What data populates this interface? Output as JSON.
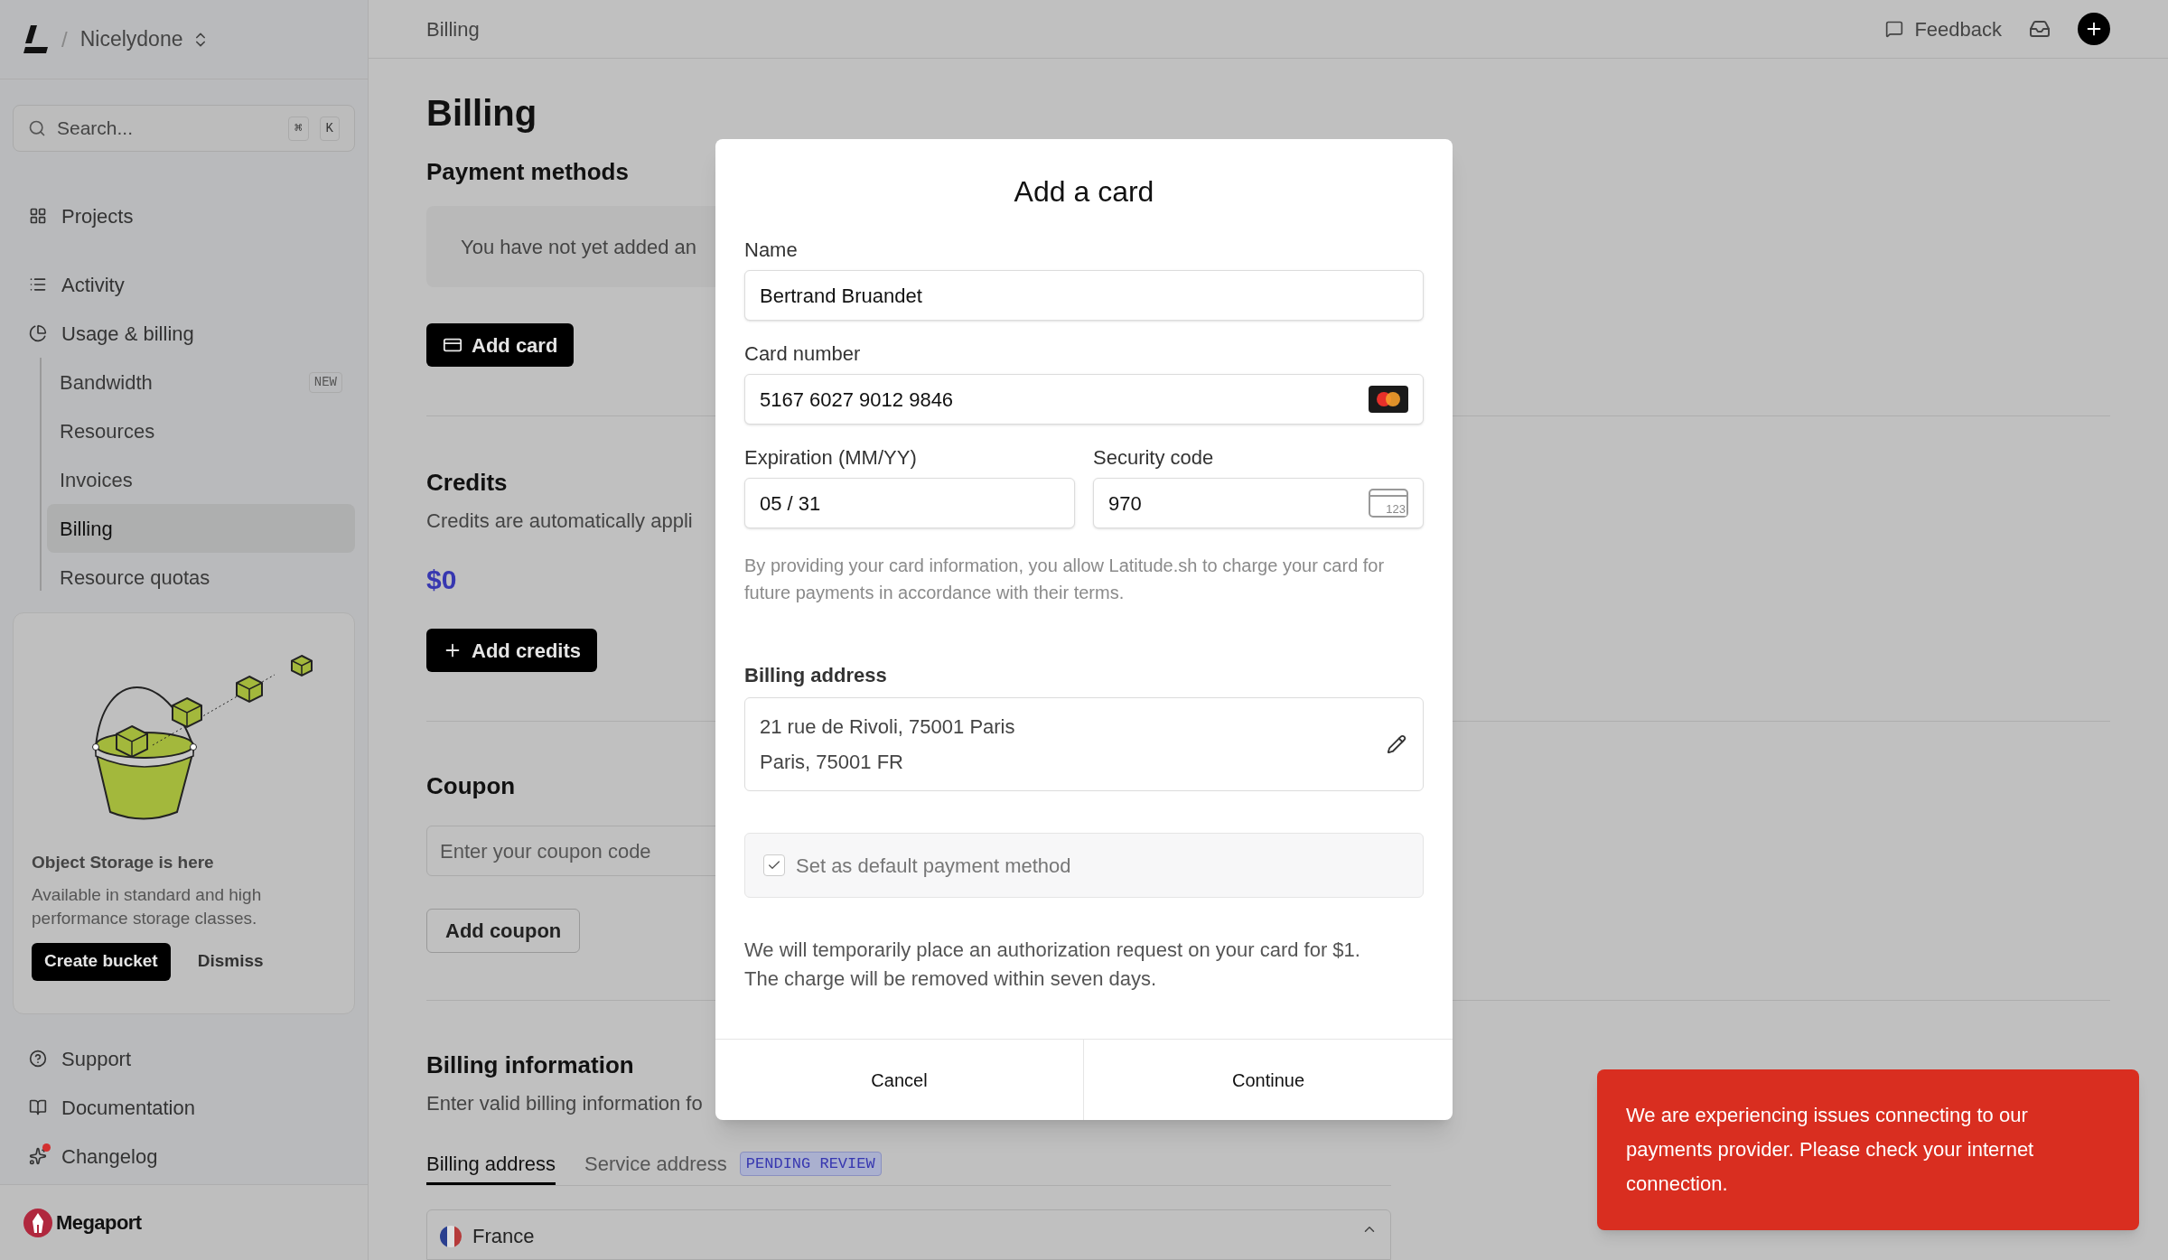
{
  "workspace": {
    "separator": "/",
    "name": "Nicelydone"
  },
  "sidebar": {
    "search": {
      "placeholder": "Search...",
      "keys": [
        "⌘",
        "K"
      ]
    },
    "nav": [
      {
        "label": "Projects"
      },
      {
        "label": "Activity"
      },
      {
        "label": "Usage & billing",
        "expanded": true,
        "children": [
          {
            "label": "Bandwidth",
            "badge": "NEW",
            "selected": false
          },
          {
            "label": "Resources",
            "selected": false
          },
          {
            "label": "Invoices",
            "selected": false
          },
          {
            "label": "Billing",
            "selected": true
          },
          {
            "label": "Resource quotas",
            "selected": false
          }
        ]
      }
    ],
    "promo": {
      "title": "Object Storage is here",
      "text": "Available in standard and high performance storage classes.",
      "primary": "Create bucket",
      "secondary": "Dismiss"
    },
    "links": [
      {
        "label": "Support",
        "dot": false
      },
      {
        "label": "Documentation",
        "dot": false
      },
      {
        "label": "Changelog",
        "dot": true
      }
    ],
    "brand": "Megaport"
  },
  "header": {
    "breadcrumb": "Billing",
    "feedback": "Feedback"
  },
  "page": {
    "title": "Billing",
    "payment": {
      "heading": "Payment methods",
      "empty": "You have not yet added an",
      "button": "Add card"
    },
    "credits": {
      "heading": "Credits",
      "text": "Credits are automatically appli",
      "amount": "$0",
      "button": "Add credits"
    },
    "coupon": {
      "heading": "Coupon",
      "placeholder": "Enter your coupon code",
      "button": "Add coupon"
    },
    "billing_info": {
      "heading": "Billing information",
      "text": "Enter valid billing information fo",
      "tabs": [
        {
          "label": "Billing address",
          "selected": true
        },
        {
          "label": "Service address",
          "selected": false,
          "badge": "PENDING REVIEW"
        }
      ],
      "country": "France"
    }
  },
  "dialog": {
    "title": "Add a card",
    "name": {
      "label": "Name",
      "value": "Bertrand Bruandet"
    },
    "card_number": {
      "label": "Card number",
      "value": "5167 6027 9012 9846"
    },
    "expiration": {
      "label": "Expiration (MM/YY)",
      "value": "05 / 31"
    },
    "security_code": {
      "label": "Security code",
      "value": "970",
      "icon_text": "123"
    },
    "disclaimer": "By providing your card information, you allow Latitude.sh to charge your card for future payments in accordance with their terms.",
    "address": {
      "label": "Billing address",
      "lines": [
        "21 rue de Rivoli, 75001 Paris",
        "Paris, 75001 FR"
      ]
    },
    "default_method": {
      "label": "Set as default payment method",
      "checked": true
    },
    "notice": [
      "We will temporarily place an authorization request on your card for $1.",
      "The charge will be removed within seven days."
    ],
    "buttons": [
      "Cancel",
      "Continue"
    ]
  },
  "toast": {
    "text": "We are experiencing issues connecting to our payments provider. Please check your internet connection."
  }
}
